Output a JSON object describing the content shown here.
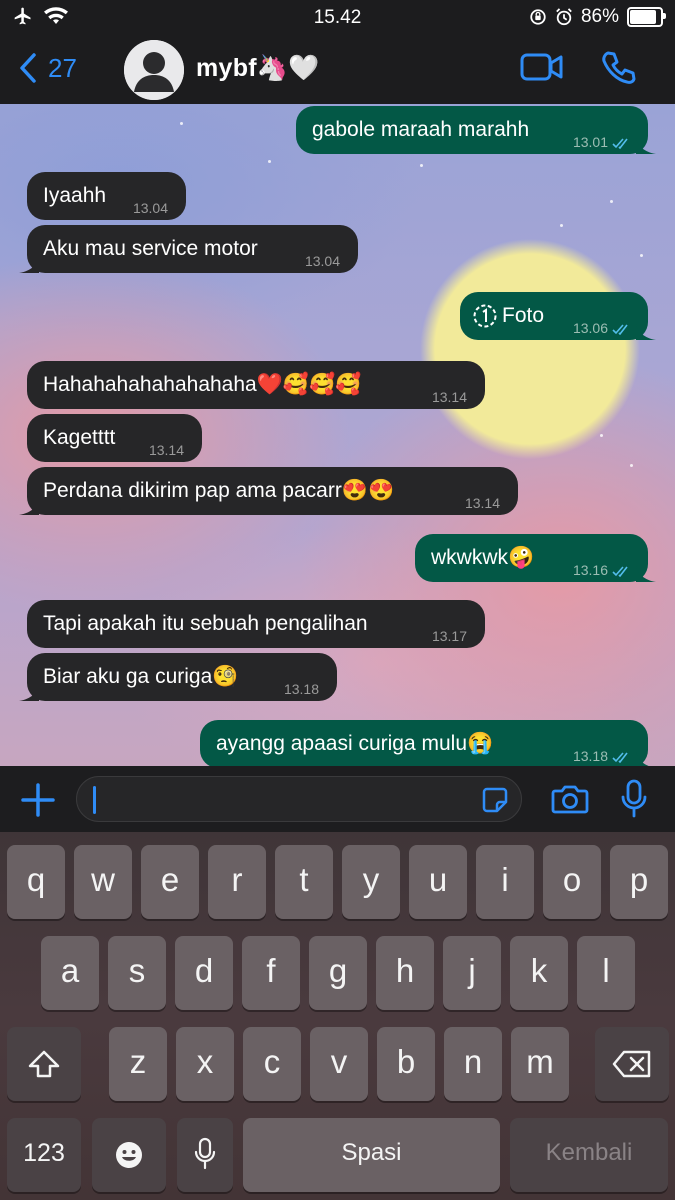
{
  "status_bar": {
    "time": "15.42",
    "battery": "86%",
    "battery_level": 0.86
  },
  "header": {
    "back_count": "27",
    "contact_name": "mybf🦄🤍",
    "icons": [
      "chevron-left-icon",
      "avatar",
      "video-call-icon",
      "phone-icon"
    ]
  },
  "messages": [
    {
      "dir": "out",
      "text": "gabole maraah marahh",
      "time": "13.01",
      "ticks": true
    },
    {
      "dir": "in",
      "text": "Iyaahh",
      "time": "13.04"
    },
    {
      "dir": "in",
      "text": "Aku mau service motor",
      "time": "13.04"
    },
    {
      "dir": "out",
      "text": "Foto",
      "time": "13.06",
      "ticks": true,
      "icon": "view-once-icon"
    },
    {
      "dir": "in",
      "text": "Hahahahahahahahaha❤️🥰🥰🥰",
      "time": "13.14"
    },
    {
      "dir": "in",
      "text": "Kagetttt",
      "time": "13.14"
    },
    {
      "dir": "in",
      "text": "Perdana dikirim pap ama pacarr😍😍",
      "time": "13.14"
    },
    {
      "dir": "out",
      "text": "wkwkwk🤪",
      "time": "13.16",
      "ticks": true
    },
    {
      "dir": "in",
      "text": "Tapi apakah itu sebuah pengalihan",
      "time": "13.17"
    },
    {
      "dir": "in",
      "text": "Biar aku ga curiga🧐",
      "time": "13.18"
    },
    {
      "dir": "out",
      "text": "ayangg apaasi curiga mulu😭",
      "time": "13.18",
      "ticks": true
    }
  ],
  "input": {
    "value": "",
    "icons": [
      "plus-icon",
      "sticker-icon",
      "camera-icon",
      "microphone-icon"
    ]
  },
  "keyboard": {
    "row1": [
      "q",
      "w",
      "e",
      "r",
      "t",
      "y",
      "u",
      "i",
      "o",
      "p"
    ],
    "row2": [
      "a",
      "s",
      "d",
      "f",
      "g",
      "h",
      "j",
      "k",
      "l"
    ],
    "row3": [
      "z",
      "x",
      "c",
      "v",
      "b",
      "n",
      "m"
    ],
    "numbers_label": "123",
    "space_label": "Spasi",
    "return_label": "Kembali"
  },
  "colors": {
    "accent": "#2f8cf6",
    "outgoing_bubble": "#035846",
    "incoming_bubble": "#262628",
    "read_ticks": "#53bdeb"
  }
}
